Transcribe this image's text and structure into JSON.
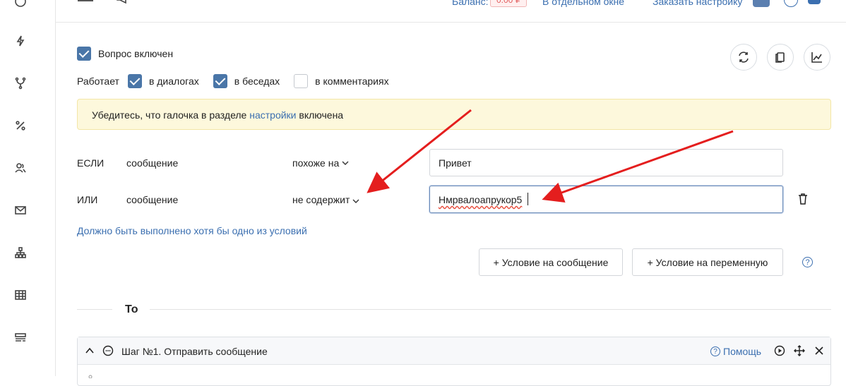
{
  "topbar": {
    "balance_label": "Баланс:",
    "balance_value": "0.00 ₽",
    "separate_window": "В отдельном окне",
    "order_setup": "Заказать настройку"
  },
  "question_enabled": {
    "label": "Вопрос включен",
    "checked": true
  },
  "works_in": {
    "label": "Работает",
    "options": [
      {
        "label": "в диалогах",
        "checked": true
      },
      {
        "label": "в беседах",
        "checked": true
      },
      {
        "label": "в комментариях",
        "checked": false
      }
    ]
  },
  "notice": {
    "before": "Убедитесь, что галочка в разделе ",
    "link": "настройки",
    "after": " включена"
  },
  "conditions": [
    {
      "connector": "ЕСЛИ",
      "subject": "сообщение",
      "operator": "похоже на",
      "value": "Привет"
    },
    {
      "connector": "ИЛИ",
      "subject": "сообщение",
      "operator": "не содержит",
      "value": "Нмрвалоапрукор5"
    }
  ],
  "conditions_hint": "Должно быть выполнено хотя бы одно из условий",
  "buttons": {
    "add_message_condition": "+ Условие на сообщение",
    "add_variable_condition": "+ Условие на переменную"
  },
  "then_label": "То",
  "step": {
    "title": "Шаг №1. Отправить сообщение",
    "help": "Помощь"
  },
  "colors": {
    "accent": "#4a76a8",
    "link": "#3b6fb0",
    "annotation_arrow": "#e41e1e",
    "notice_bg": "#fdf8dc"
  }
}
